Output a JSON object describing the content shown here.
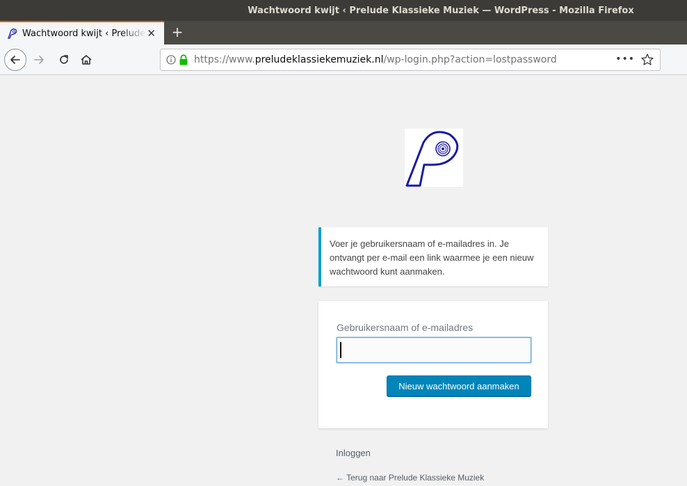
{
  "window": {
    "title": "Wachtwoord kwijt ‹ Prelude Klassieke Muziek — WordPress - Mozilla Firefox"
  },
  "tab": {
    "title": "Wachtwoord kwijt ‹ Prelude Klassieke Muziek",
    "close_glyph": "✕",
    "new_tab_glyph": "+"
  },
  "navbar": {
    "url_prefix": "https://www.",
    "url_domain": "preludeklassiekemuziek.nl",
    "url_path": "/wp-login.php?action=lostpassword",
    "more_glyph": "•••"
  },
  "page": {
    "notice": "Voer je gebruikersnaam of e-mailadres in. Je ontvangt per e-mail een link waarmee je een nieuw wachtwoord kunt aanmaken.",
    "form": {
      "label": "Gebruikersnaam of e-mailadres",
      "input_value": "",
      "submit_label": "Nieuw wachtwoord aanmaken"
    },
    "login_link": "Inloggen",
    "back_link": "← Terug naar Prelude Klassieke Muziek"
  },
  "colors": {
    "accent": "#0085ba",
    "notice_border": "#00a0d2",
    "tab_highlight": "#e66000",
    "logo_blue": "#1a1aa6"
  }
}
